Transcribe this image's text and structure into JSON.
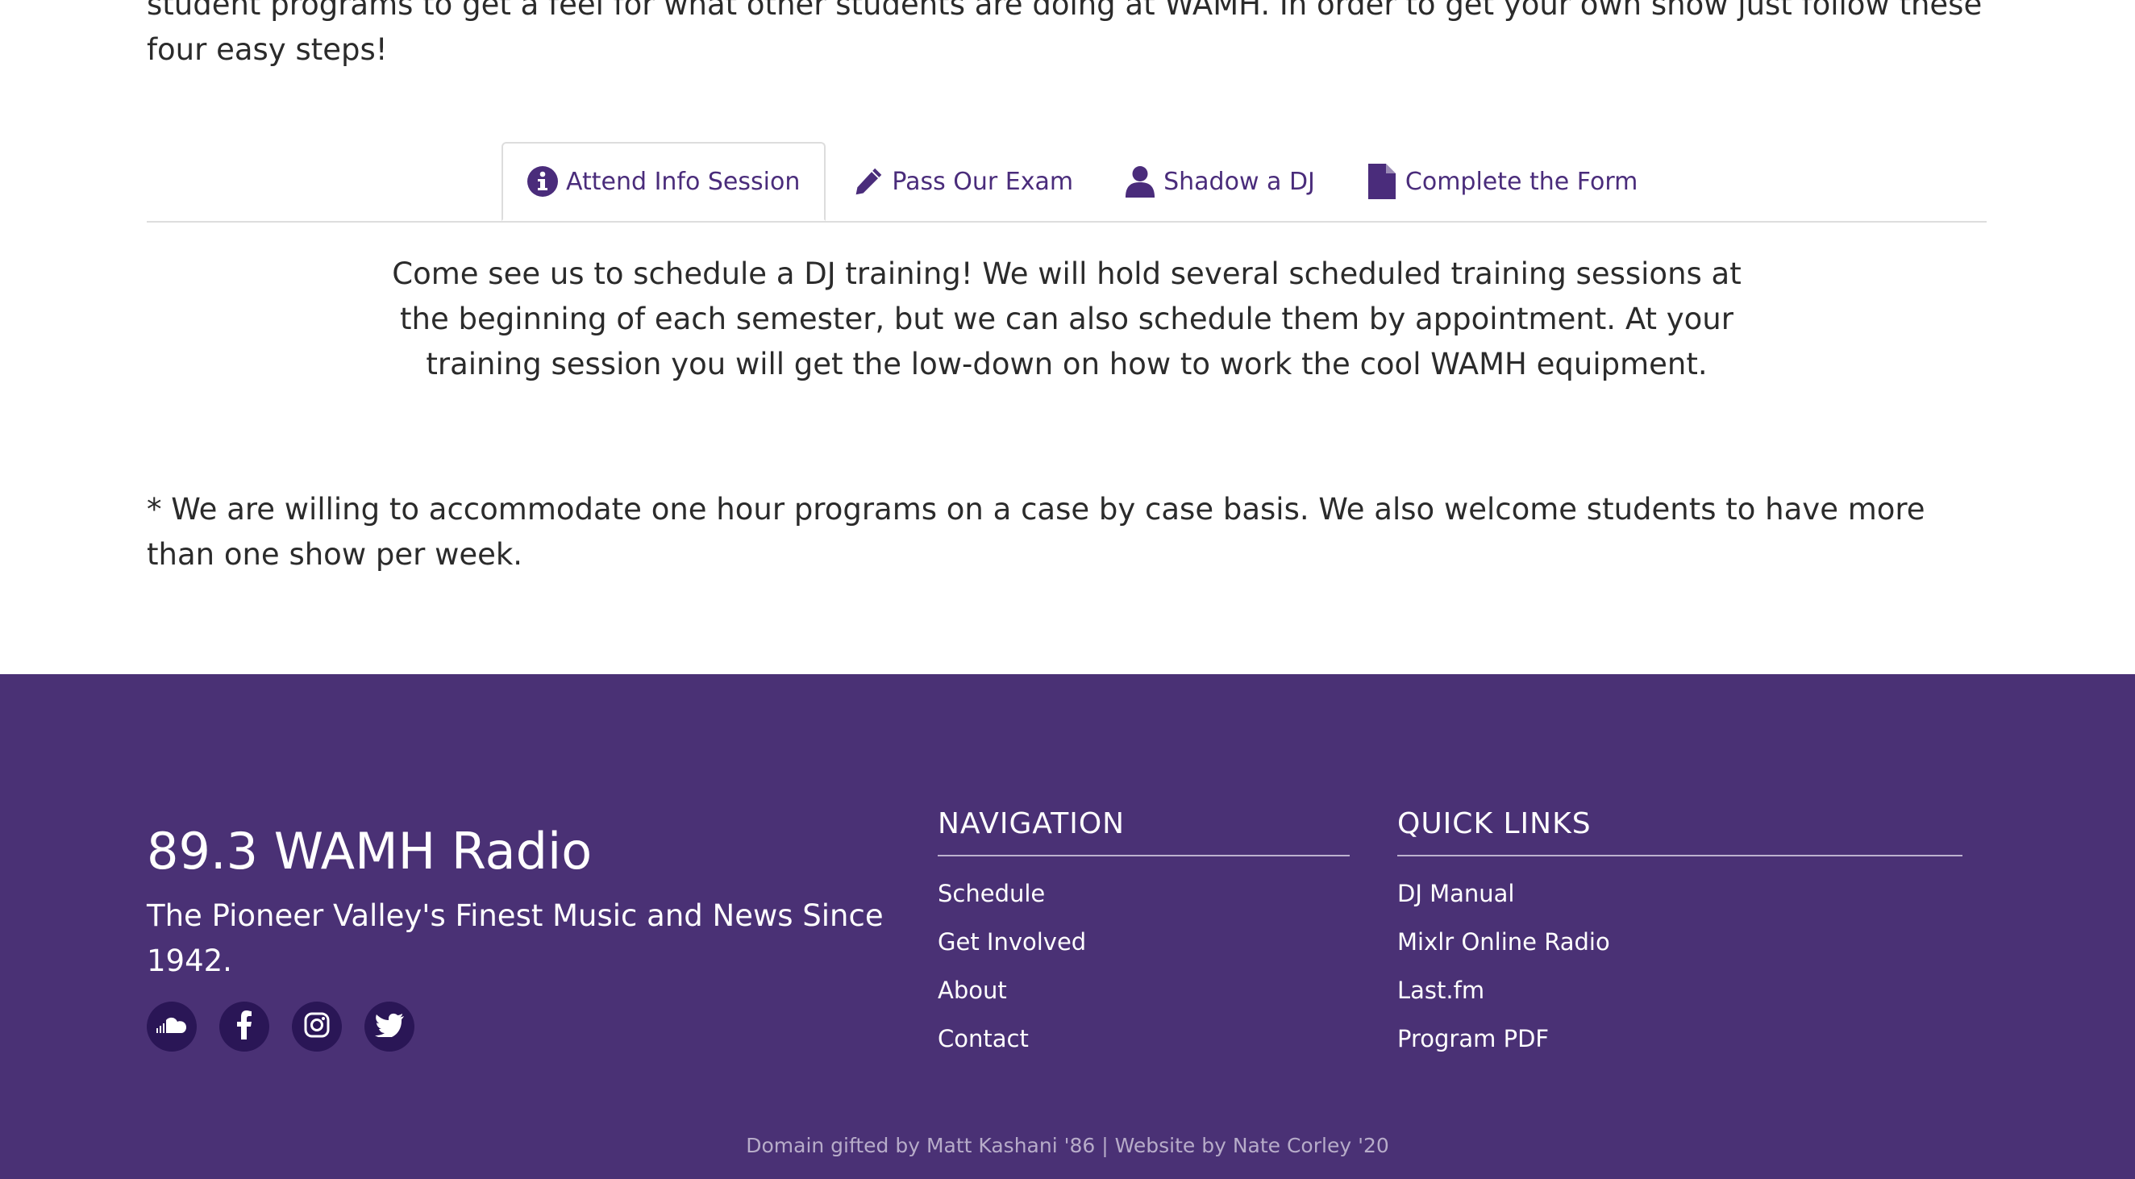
{
  "intro": {
    "text_top": "student programs to get a feel for what other students are doing at WAMH. In order to get your own show just follow these",
    "text_bottom": "four easy steps!"
  },
  "tabs": [
    {
      "label": "Attend Info Session",
      "icon": "info-circle-icon",
      "active": true
    },
    {
      "label": "Pass Our Exam",
      "icon": "pencil-icon",
      "active": false
    },
    {
      "label": "Shadow a DJ",
      "icon": "user-icon",
      "active": false
    },
    {
      "label": "Complete the Form",
      "icon": "file-icon",
      "active": false
    }
  ],
  "tab_content": "Come see us to schedule a DJ training! We will hold several scheduled training sessions at the beginning of each semester, but we can also schedule them by appointment. At your training session you will get the low-down on how to work the cool WAMH equipment.",
  "note": "* We are willing to accommodate one hour programs on a case by case basis. We also welcome students to have more than one show per week.",
  "footer": {
    "title": "89.3 WAMH Radio",
    "tagline": "The Pioneer Valley's Finest Music and News Since 1942.",
    "social": [
      "soundcloud-icon",
      "facebook-icon",
      "instagram-icon",
      "twitter-icon"
    ],
    "navigation": {
      "heading": "NAVIGATION",
      "links": [
        "Schedule",
        "Get Involved",
        "About",
        "Contact"
      ]
    },
    "quick_links": {
      "heading": "QUICK LINKS",
      "links": [
        "DJ Manual",
        "Mixlr Online Radio",
        "Last.fm",
        "Program PDF"
      ]
    },
    "credit": "Domain gifted by Matt Kashani '86 | Website by Nate Corley '20"
  },
  "colors": {
    "footer_bg": "#4a3175",
    "accent": "#4a2c7b",
    "social_bg": "#2a1656"
  }
}
